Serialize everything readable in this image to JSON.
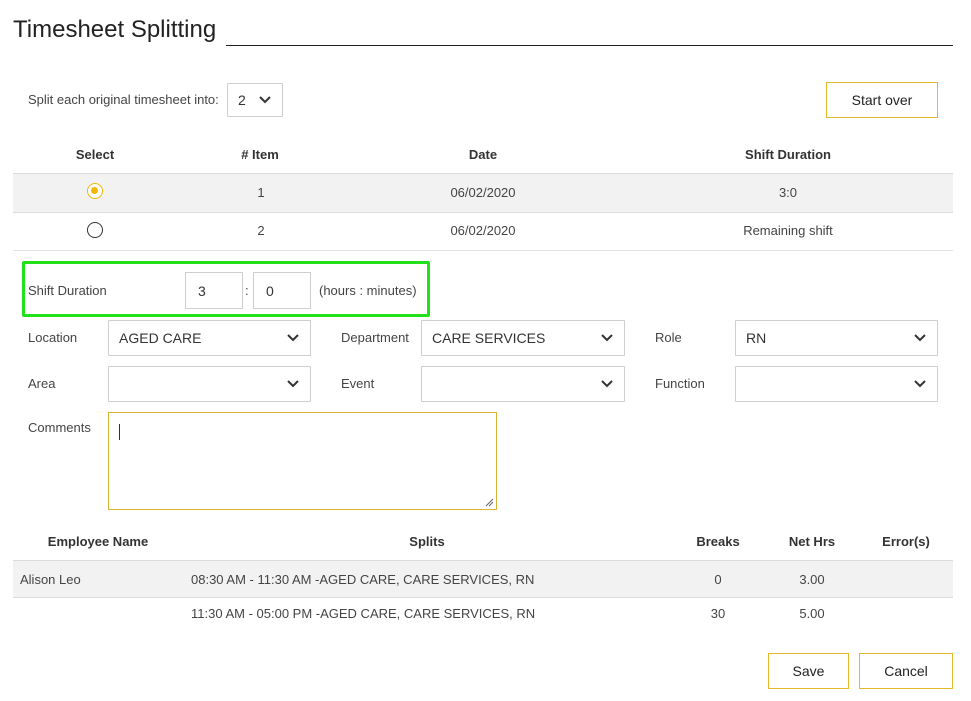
{
  "page": {
    "title": "Timesheet Splitting"
  },
  "split_control": {
    "label": "Split each original timesheet into:",
    "value": "2"
  },
  "buttons": {
    "start_over": "Start over",
    "save": "Save",
    "cancel": "Cancel"
  },
  "items_table": {
    "headers": {
      "select": "Select",
      "item": "# Item",
      "date": "Date",
      "duration": "Shift Duration"
    },
    "rows": [
      {
        "selected": true,
        "item": "1",
        "date": "06/02/2020",
        "duration": "3:0"
      },
      {
        "selected": false,
        "item": "2",
        "date": "06/02/2020",
        "duration": "Remaining shift"
      }
    ]
  },
  "shift_duration": {
    "label": "Shift Duration",
    "hours": "3",
    "separator": ":",
    "minutes": "0",
    "unit_hint": "(hours : minutes)"
  },
  "fields": {
    "location": {
      "label": "Location",
      "value": "AGED CARE"
    },
    "department": {
      "label": "Department",
      "value": "CARE SERVICES"
    },
    "role": {
      "label": "Role",
      "value": "RN"
    },
    "area": {
      "label": "Area",
      "value": ""
    },
    "event": {
      "label": "Event",
      "value": ""
    },
    "function": {
      "label": "Function",
      "value": ""
    },
    "comments": {
      "label": "Comments",
      "value": ""
    }
  },
  "splits_table": {
    "headers": {
      "employee": "Employee Name",
      "splits": "Splits",
      "breaks": "Breaks",
      "net_hrs": "Net Hrs",
      "errors": "Error(s)"
    },
    "rows": [
      {
        "employee": "Alison Leo",
        "split": "08:30 AM - 11:30 AM -AGED CARE, CARE SERVICES, RN",
        "breaks": "0",
        "net_hrs": "3.00",
        "errors": ""
      },
      {
        "employee": "",
        "split": "11:30 AM - 05:00 PM -AGED CARE, CARE SERVICES, RN",
        "breaks": "30",
        "net_hrs": "5.00",
        "errors": ""
      }
    ]
  },
  "colors": {
    "accent": "#f2b705",
    "button_border": "#e5b82a",
    "highlight": "#22e01a",
    "row_shade": "#f2f2f2"
  },
  "icons": {
    "dropdown": "chevron-down-icon",
    "radio_on": "radio-selected-icon",
    "radio_off": "radio-unselected-icon",
    "resize": "resize-handle-icon"
  }
}
